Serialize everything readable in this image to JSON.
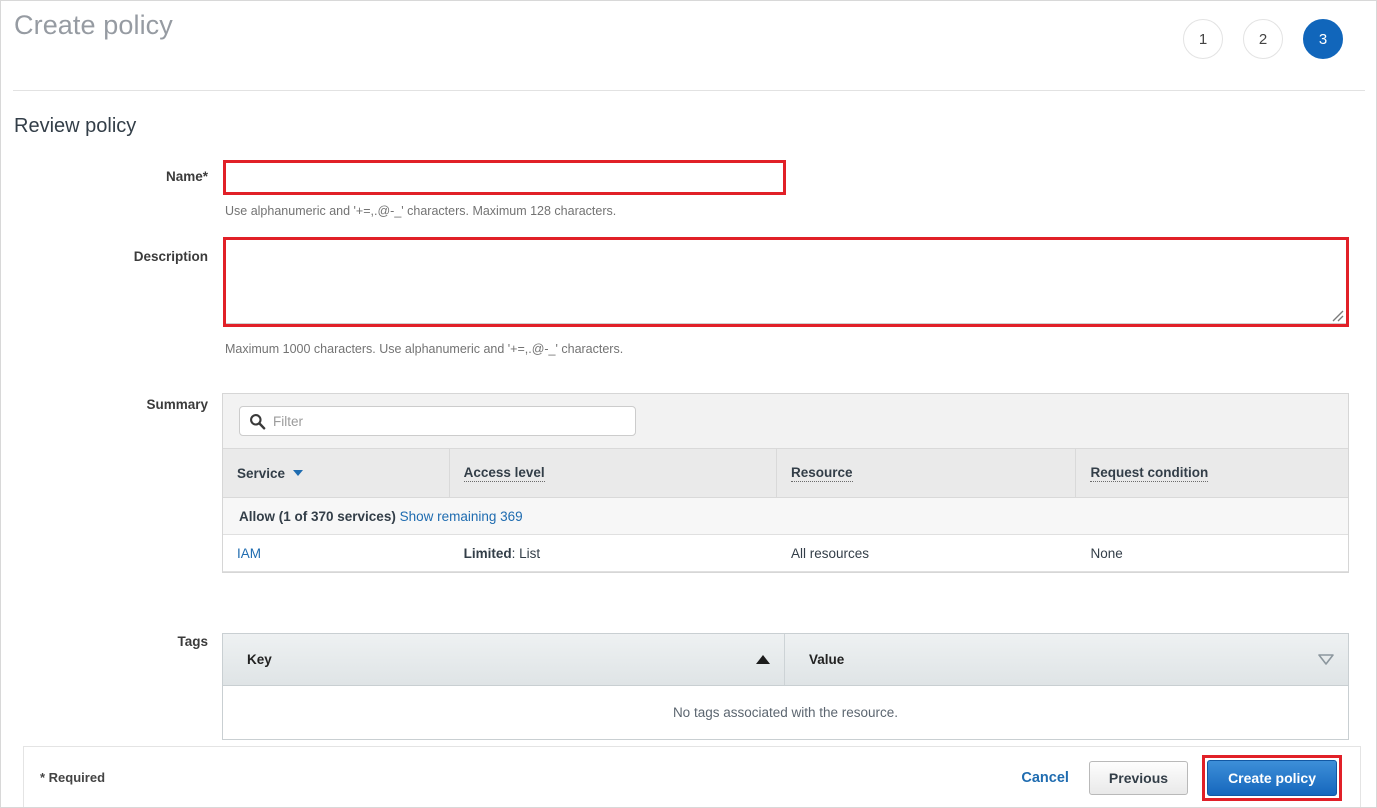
{
  "wizard": {
    "title": "Create policy",
    "steps": [
      {
        "label": "1",
        "active": false
      },
      {
        "label": "2",
        "active": false
      },
      {
        "label": "3",
        "active": true
      }
    ]
  },
  "section": {
    "heading": "Review policy"
  },
  "form": {
    "name": {
      "label": "Name*",
      "value": "",
      "placeholder": "",
      "hint": "Use alphanumeric and '+=,.@-_' characters. Maximum 128 characters.",
      "highlight_color": "#e12028"
    },
    "description": {
      "label": "Description",
      "value": "",
      "placeholder": "",
      "hint": "Maximum 1000 characters. Use alphanumeric and '+=,.@-_' characters.",
      "highlight_color": "#e12028"
    }
  },
  "summary": {
    "label": "Summary",
    "filter": {
      "placeholder": "Filter",
      "value": "",
      "icon": "search-icon"
    },
    "columns": [
      {
        "label": "Service",
        "sort": "desc",
        "sort_icon": "caret-down-icon",
        "tooltip": false
      },
      {
        "label": "Access level",
        "tooltip": true
      },
      {
        "label": "Resource",
        "tooltip": true
      },
      {
        "label": "Request condition",
        "tooltip": true
      }
    ],
    "group_row": {
      "effect": "Allow (1 of 370 services)",
      "show_remaining_link": "Show remaining 369"
    },
    "rows": [
      {
        "service": "IAM",
        "access_level_prefix": "Limited",
        "access_level_suffix": ": List",
        "resource": "All resources",
        "request_condition": "None"
      }
    ]
  },
  "tags": {
    "label": "Tags",
    "columns": [
      {
        "label": "Key",
        "sort_icon": "triangle-up-icon"
      },
      {
        "label": "Value",
        "sort_icon": "triangle-down-outline-icon"
      }
    ],
    "empty_message": "No tags associated with the resource."
  },
  "footer": {
    "required_note": "* Required",
    "cancel_label": "Cancel",
    "previous_label": "Previous",
    "create_label": "Create policy",
    "create_highlight_color": "#e12028",
    "accent_color": "#1f6cb0"
  }
}
